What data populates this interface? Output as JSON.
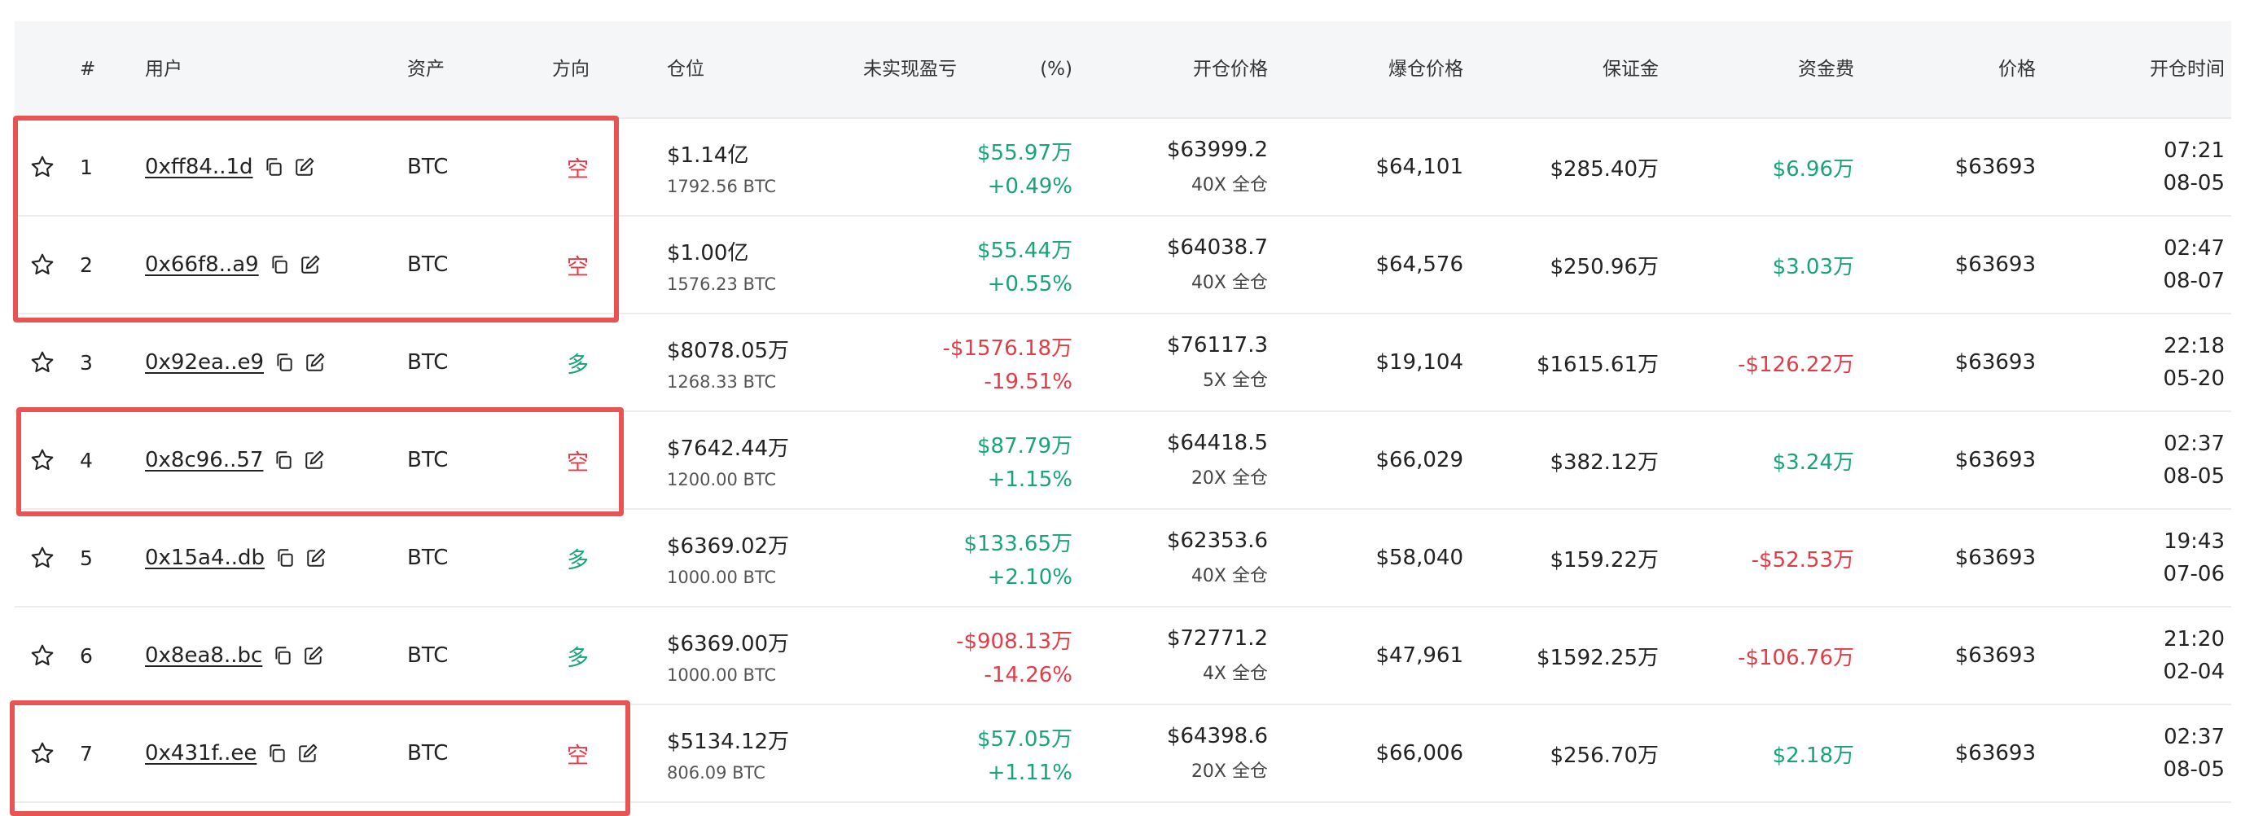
{
  "headers": {
    "index": "#",
    "user": "用户",
    "asset": "资产",
    "direction": "方向",
    "position": "仓位",
    "unrealized": "未实现盈亏",
    "percent": "(%)",
    "open_price": "开仓价格",
    "liq_price": "爆仓价格",
    "margin": "保证金",
    "funding": "资金费",
    "price": "价格",
    "open_time": "开仓时间"
  },
  "colors": {
    "profit": "#1aa37a",
    "loss": "#e23c47",
    "highlight": "#e85454",
    "header_bg": "#f5f6f8"
  },
  "rows": [
    {
      "index": "1",
      "address": "0xff84..1d",
      "asset": "BTC",
      "direction": "空",
      "side": "short",
      "position_usd": "$1.14亿",
      "position_btc": "1792.56 BTC",
      "pnl": "$55.97万",
      "pnl_pct": "+0.49%",
      "pnl_sign": "positive",
      "open_price": "$63999.2",
      "leverage": "40X 全仓",
      "liq_price": "$64,101",
      "margin": "$285.40万",
      "funding": "$6.96万",
      "funding_sign": "positive",
      "price": "$63693",
      "time": "07:21",
      "date": "08-05",
      "highlighted": true
    },
    {
      "index": "2",
      "address": "0x66f8..a9",
      "asset": "BTC",
      "direction": "空",
      "side": "short",
      "position_usd": "$1.00亿",
      "position_btc": "1576.23 BTC",
      "pnl": "$55.44万",
      "pnl_pct": "+0.55%",
      "pnl_sign": "positive",
      "open_price": "$64038.7",
      "leverage": "40X 全仓",
      "liq_price": "$64,576",
      "margin": "$250.96万",
      "funding": "$3.03万",
      "funding_sign": "positive",
      "price": "$63693",
      "time": "02:47",
      "date": "08-07",
      "highlighted": true
    },
    {
      "index": "3",
      "address": "0x92ea..e9",
      "asset": "BTC",
      "direction": "多",
      "side": "long",
      "position_usd": "$8078.05万",
      "position_btc": "1268.33 BTC",
      "pnl": "-$1576.18万",
      "pnl_pct": "-19.51%",
      "pnl_sign": "negative",
      "open_price": "$76117.3",
      "leverage": "5X 全仓",
      "liq_price": "$19,104",
      "margin": "$1615.61万",
      "funding": "-$126.22万",
      "funding_sign": "negative",
      "price": "$63693",
      "time": "22:18",
      "date": "05-20",
      "highlighted": false
    },
    {
      "index": "4",
      "address": "0x8c96..57",
      "asset": "BTC",
      "direction": "空",
      "side": "short",
      "position_usd": "$7642.44万",
      "position_btc": "1200.00 BTC",
      "pnl": "$87.79万",
      "pnl_pct": "+1.15%",
      "pnl_sign": "positive",
      "open_price": "$64418.5",
      "leverage": "20X 全仓",
      "liq_price": "$66,029",
      "margin": "$382.12万",
      "funding": "$3.24万",
      "funding_sign": "positive",
      "price": "$63693",
      "time": "02:37",
      "date": "08-05",
      "highlighted": true
    },
    {
      "index": "5",
      "address": "0x15a4..db",
      "asset": "BTC",
      "direction": "多",
      "side": "long",
      "position_usd": "$6369.02万",
      "position_btc": "1000.00 BTC",
      "pnl": "$133.65万",
      "pnl_pct": "+2.10%",
      "pnl_sign": "positive",
      "open_price": "$62353.6",
      "leverage": "40X 全仓",
      "liq_price": "$58,040",
      "margin": "$159.22万",
      "funding": "-$52.53万",
      "funding_sign": "negative",
      "price": "$63693",
      "time": "19:43",
      "date": "07-06",
      "highlighted": false
    },
    {
      "index": "6",
      "address": "0x8ea8..bc",
      "asset": "BTC",
      "direction": "多",
      "side": "long",
      "position_usd": "$6369.00万",
      "position_btc": "1000.00 BTC",
      "pnl": "-$908.13万",
      "pnl_pct": "-14.26%",
      "pnl_sign": "negative",
      "open_price": "$72771.2",
      "leverage": "4X 全仓",
      "liq_price": "$47,961",
      "margin": "$1592.25万",
      "funding": "-$106.76万",
      "funding_sign": "negative",
      "price": "$63693",
      "time": "21:20",
      "date": "02-04",
      "highlighted": false
    },
    {
      "index": "7",
      "address": "0x431f..ee",
      "asset": "BTC",
      "direction": "空",
      "side": "short",
      "position_usd": "$5134.12万",
      "position_btc": "806.09 BTC",
      "pnl": "$57.05万",
      "pnl_pct": "+1.11%",
      "pnl_sign": "positive",
      "open_price": "$64398.6",
      "leverage": "20X 全仓",
      "liq_price": "$66,006",
      "margin": "$256.70万",
      "funding": "$2.18万",
      "funding_sign": "positive",
      "price": "$63693",
      "time": "02:37",
      "date": "08-05",
      "highlighted": true
    }
  ]
}
